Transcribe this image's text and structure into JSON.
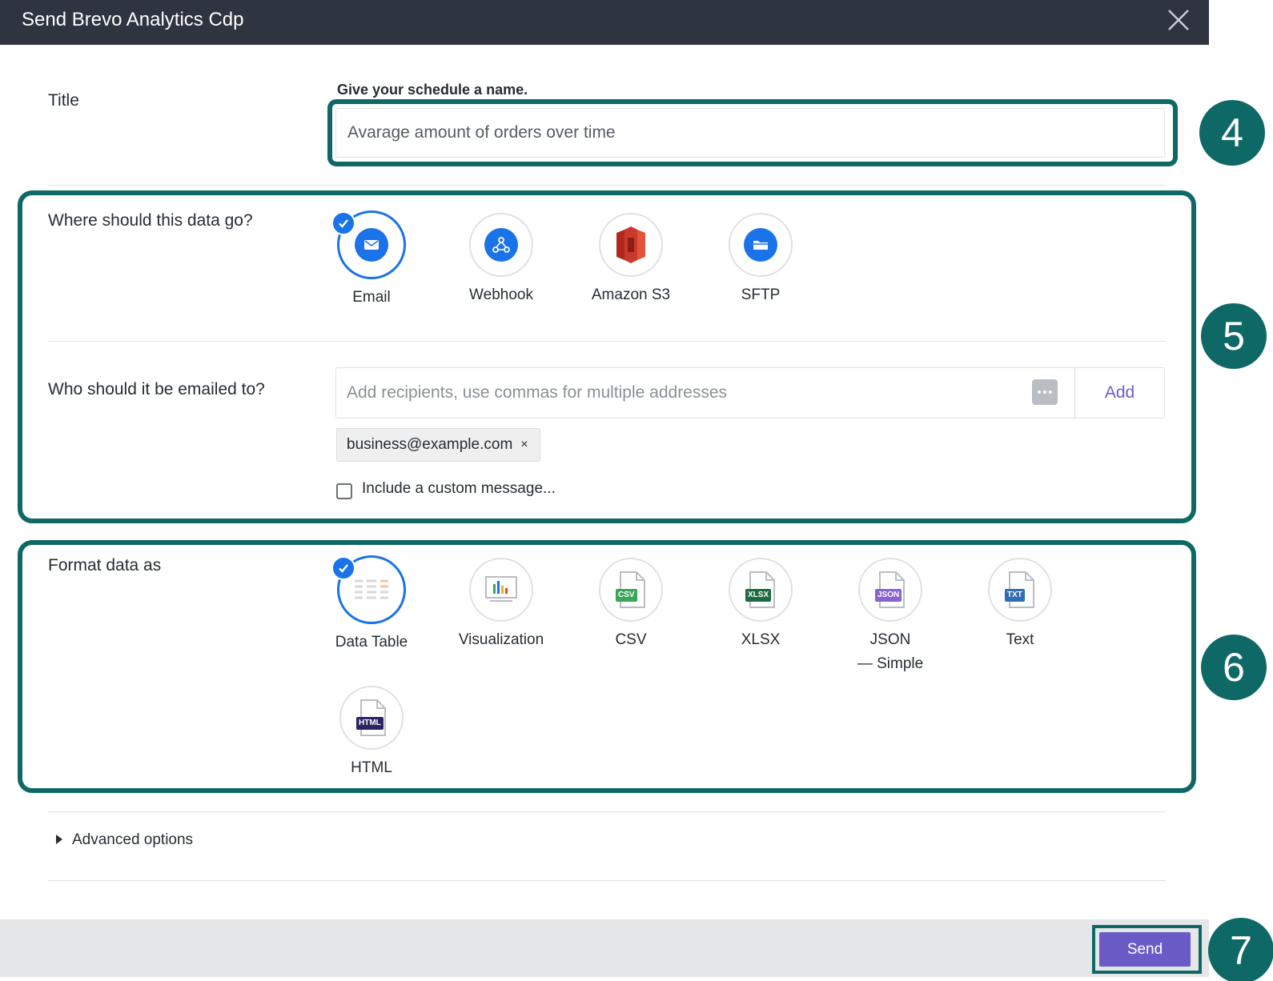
{
  "dialog": {
    "title": "Send Brevo Analytics Cdp"
  },
  "title_section": {
    "label": "Title",
    "hint": "Give your schedule a name.",
    "value": "Avarage amount of orders over time"
  },
  "destination": {
    "label": "Where should this data go?",
    "options": [
      {
        "label": "Email",
        "icon": "email-icon",
        "selected": true
      },
      {
        "label": "Webhook",
        "icon": "webhook-icon",
        "selected": false
      },
      {
        "label": "Amazon S3",
        "icon": "amazon-s3-icon",
        "selected": false
      },
      {
        "label": "SFTP",
        "icon": "folder-icon",
        "selected": false
      }
    ]
  },
  "recipients": {
    "label": "Who should it be emailed to?",
    "placeholder": "Add recipients, use commas for multiple addresses",
    "add_label": "Add",
    "chips": [
      "business@example.com"
    ],
    "chip_remove": "×",
    "custom_message_label": "Include a custom message..."
  },
  "format": {
    "label": "Format data as",
    "options": [
      {
        "label": "Data Table",
        "selected": true
      },
      {
        "label": "Visualization",
        "selected": false
      },
      {
        "label": "CSV",
        "tag": "CSV",
        "tag_color": "#3aa757",
        "selected": false
      },
      {
        "label": "XLSX",
        "tag": "XLSX",
        "tag_color": "#1e6b42",
        "selected": false
      },
      {
        "label": "JSON",
        "sublabel": "— Simple",
        "tag": "JSON",
        "tag_color": "#8a63d2",
        "selected": false
      },
      {
        "label": "Text",
        "tag": "TXT",
        "tag_color": "#2f6db5",
        "selected": false
      },
      {
        "label": "HTML",
        "tag": "HTML",
        "tag_color": "#2a2366",
        "selected": false
      }
    ]
  },
  "advanced": {
    "label": "Advanced options"
  },
  "footer": {
    "send_label": "Send"
  },
  "annotations": [
    "4",
    "5",
    "6",
    "7"
  ],
  "colors": {
    "header_bg": "#2f3441",
    "accent_teal": "#0e6966",
    "primary_blue": "#1a73e8",
    "send_purple": "#6b5bc6"
  }
}
